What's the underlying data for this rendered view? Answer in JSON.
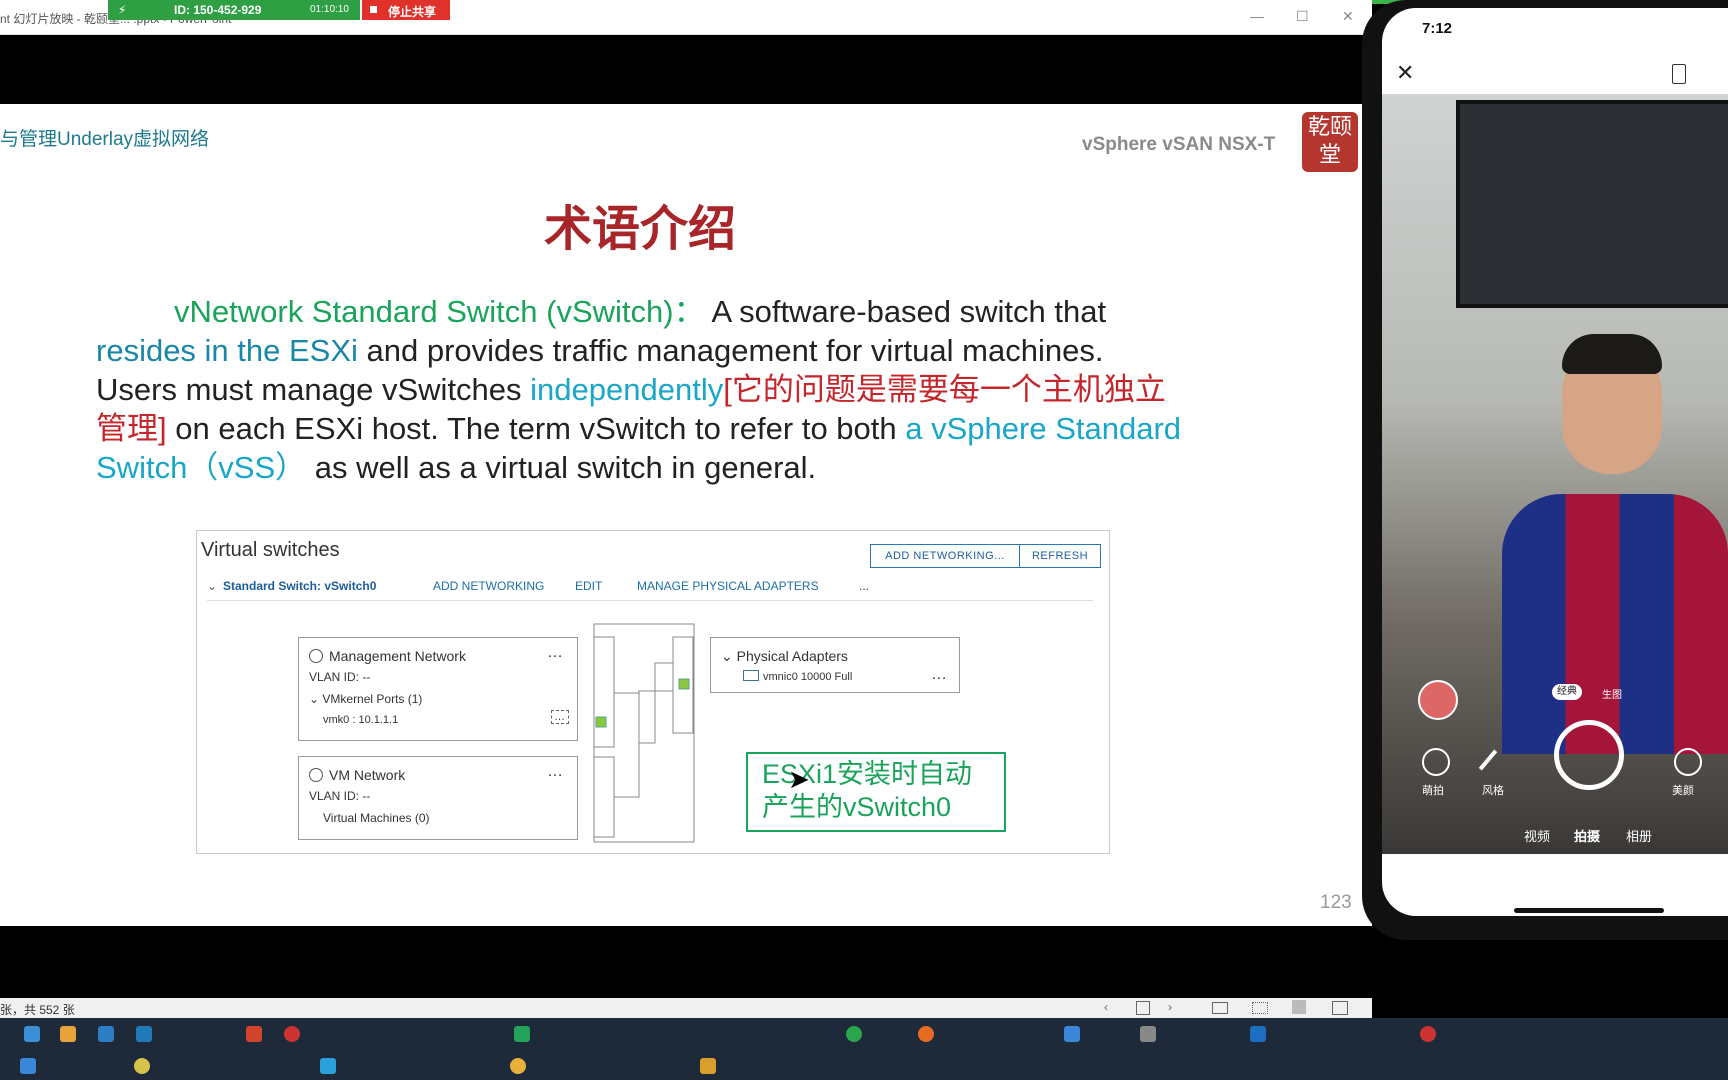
{
  "window": {
    "title": "nt 幻灯片放映 - 乾颐堂... .pptx - PowerPoint",
    "min": "—",
    "max": "☐",
    "close": "✕"
  },
  "meeting": {
    "id": "ID: 150-452-929",
    "time": "01:10:10",
    "stop_share": "停止共享"
  },
  "slide": {
    "breadcrumb": "与管理Underlay虚拟网络",
    "brand": "vSphere vSAN NSX-T",
    "seal_text": "乾颐堂",
    "title": "术语介绍",
    "para": {
      "term": "vNetwork Standard Switch (vSwitch)：",
      "t1": "  A software-based switch that",
      "resides": "resides in the ESXi",
      "t2": " and provides traffic management for virtual machines.",
      "t3": "Users must manage vSwitches ",
      "indep": "independently",
      "cn": "[它的问题是需要每一个主机独立管理]",
      "t4": " on each ESXi host. The term vSwitch to refer to both ",
      "vss": "a vSphere Standard Switch（vSS）",
      "t5": "  as well as a virtual switch in general."
    },
    "page_number": "123"
  },
  "vsphere": {
    "title": "Virtual switches",
    "add_networking_btn": "ADD NETWORKING...",
    "refresh_btn": "REFRESH",
    "switch_name": "Standard Switch: vSwitch0",
    "add_networking": "ADD NETWORKING",
    "edit": "EDIT",
    "manage_adapters": "MANAGE PHYSICAL ADAPTERS",
    "more": "...",
    "mgmt": {
      "name": "Management Network",
      "vlan": "VLAN ID: --",
      "ports": "VMkernel Ports (1)",
      "vmk": "vmk0 : 10.1.1.1"
    },
    "vmnet": {
      "name": "VM Network",
      "vlan": "VLAN ID: --",
      "vms": "Virtual Machines (0)"
    },
    "adapters": {
      "name": "Physical Adapters",
      "nic": "vmnic0 10000 Full"
    },
    "callout": "ESXi1安装时自动产生的vSwitch0"
  },
  "statusbar": {
    "slide_info": "张，共 552 张"
  },
  "phone": {
    "clock": "7:12",
    "modes": [
      "视频",
      "拍摄",
      "相册"
    ],
    "tools": [
      "萌拍",
      "风格",
      "美颜"
    ],
    "filters": [
      "经典",
      "生图"
    ]
  }
}
